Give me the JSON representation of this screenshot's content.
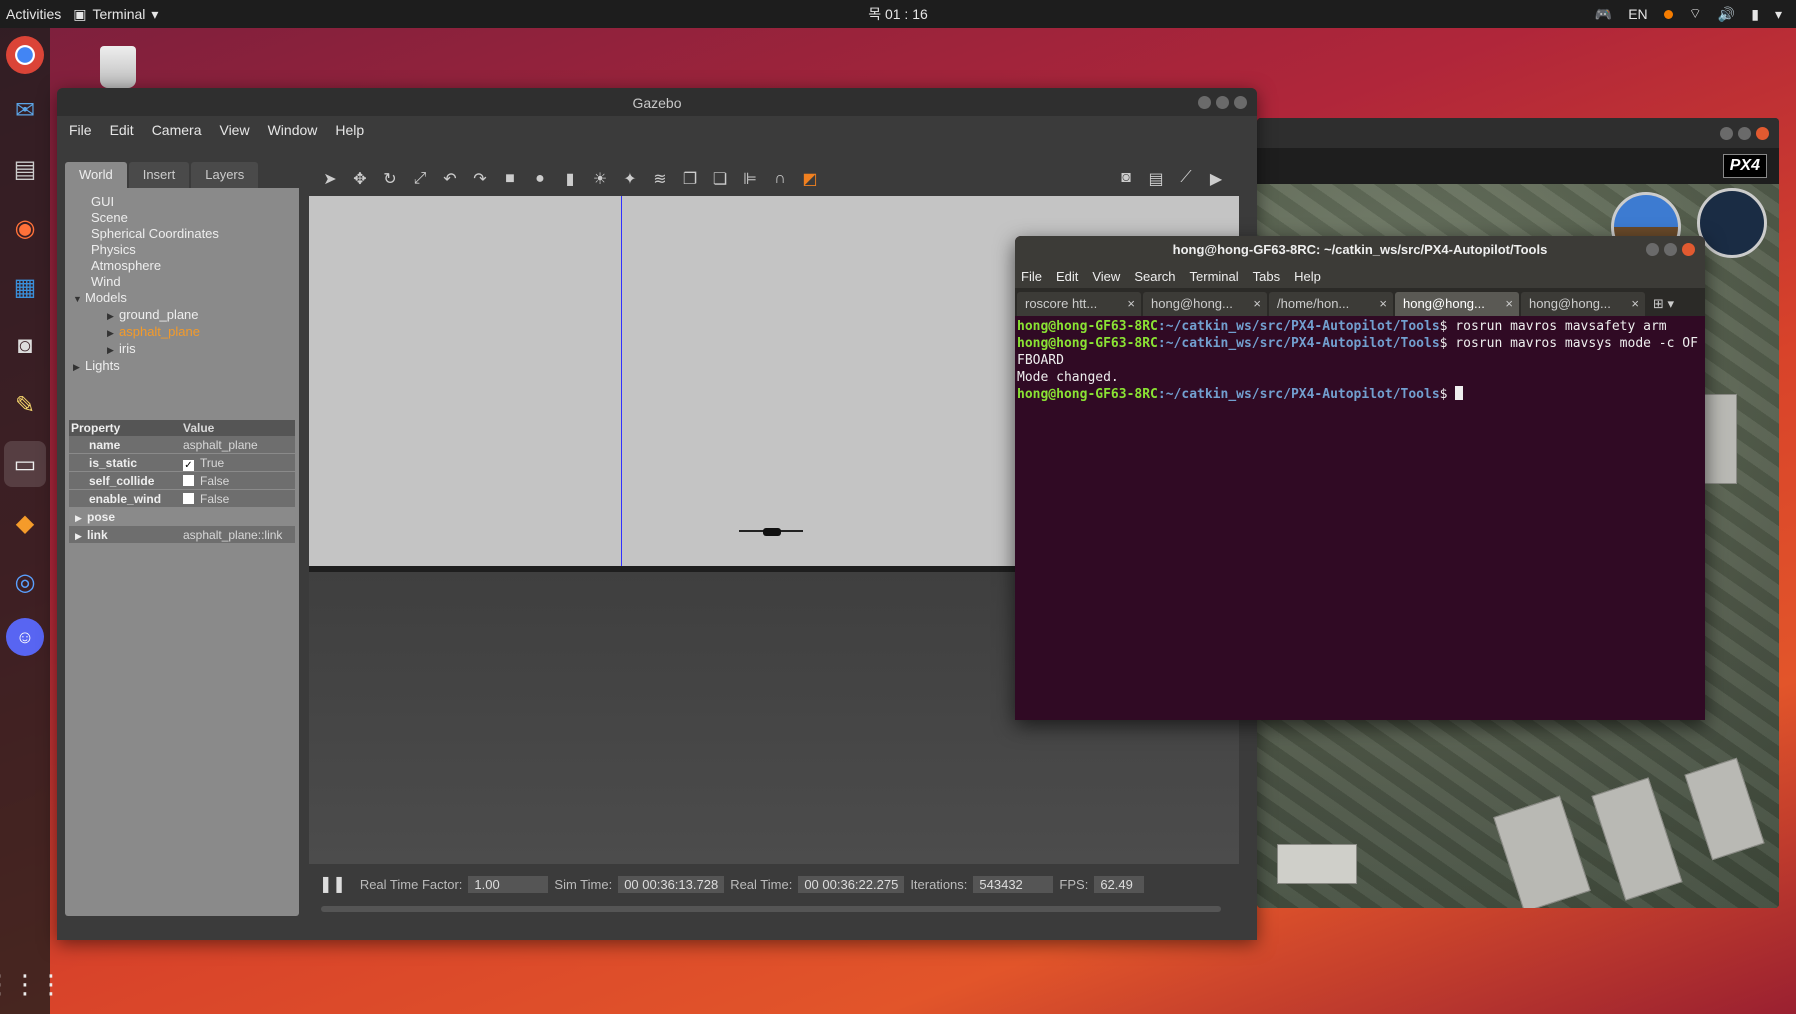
{
  "topbar": {
    "activities": "Activities",
    "app_name": "Terminal",
    "clock": "목 01 : 16",
    "lang": "EN"
  },
  "dock": {
    "apps": [
      "chrome-icon",
      "thunderbird-icon",
      "files-icon",
      "firefox-icon",
      "writer-icon",
      "camera-icon",
      "editor-icon",
      "terminal-icon",
      "sublime-icon",
      "qgroundcontrol-icon",
      "discord-icon"
    ]
  },
  "gazebo": {
    "title": "Gazebo",
    "menu": [
      "File",
      "Edit",
      "Camera",
      "View",
      "Window",
      "Help"
    ],
    "tabs": [
      "World",
      "Insert",
      "Layers"
    ],
    "tree": {
      "gui": "GUI",
      "scene": "Scene",
      "spherical": "Spherical Coordinates",
      "physics": "Physics",
      "atmosphere": "Atmosphere",
      "wind": "Wind",
      "models": "Models",
      "model_items": [
        "ground_plane",
        "asphalt_plane",
        "iris"
      ],
      "lights": "Lights"
    },
    "properties": {
      "header_property": "Property",
      "header_value": "Value",
      "rows": [
        {
          "name": "name",
          "value": "asphalt_plane"
        },
        {
          "name": "is_static",
          "value": "True",
          "checked": true
        },
        {
          "name": "self_collide",
          "value": "False",
          "checked": false
        },
        {
          "name": "enable_wind",
          "value": "False",
          "checked": false
        },
        {
          "name": "pose",
          "value": ""
        },
        {
          "name": "link",
          "value": "asphalt_plane::link"
        }
      ]
    },
    "status": {
      "rtf_label": "Real Time Factor:",
      "rtf": "1.00",
      "sim_label": "Sim Time:",
      "sim": "00 00:36:13.728",
      "real_label": "Real Time:",
      "real": "00 00:36:22.275",
      "iter_label": "Iterations:",
      "iter": "543432",
      "fps_label": "FPS:",
      "fps": "62.49"
    }
  },
  "map": {
    "brand": "PX4"
  },
  "terminal": {
    "title": "hong@hong-GF63-8RC: ~/catkin_ws/src/PX4-Autopilot/Tools",
    "menu": [
      "File",
      "Edit",
      "View",
      "Search",
      "Terminal",
      "Tabs",
      "Help"
    ],
    "tabs": [
      "roscore htt...",
      "hong@hong...",
      "/home/hon...",
      "hong@hong...",
      "hong@hong..."
    ],
    "active_tab": 3,
    "prompt_user": "hong@hong-GF63-8RC",
    "prompt_path": ":~/catkin_ws/src/PX4-Autopilot/Tools",
    "cmd1": "$ rosrun mavros mavsafety arm",
    "cmd2": "$ rosrun mavros mavsys mode -c OFFBOARD",
    "out2": "Mode changed.",
    "cmd3": "$ "
  }
}
